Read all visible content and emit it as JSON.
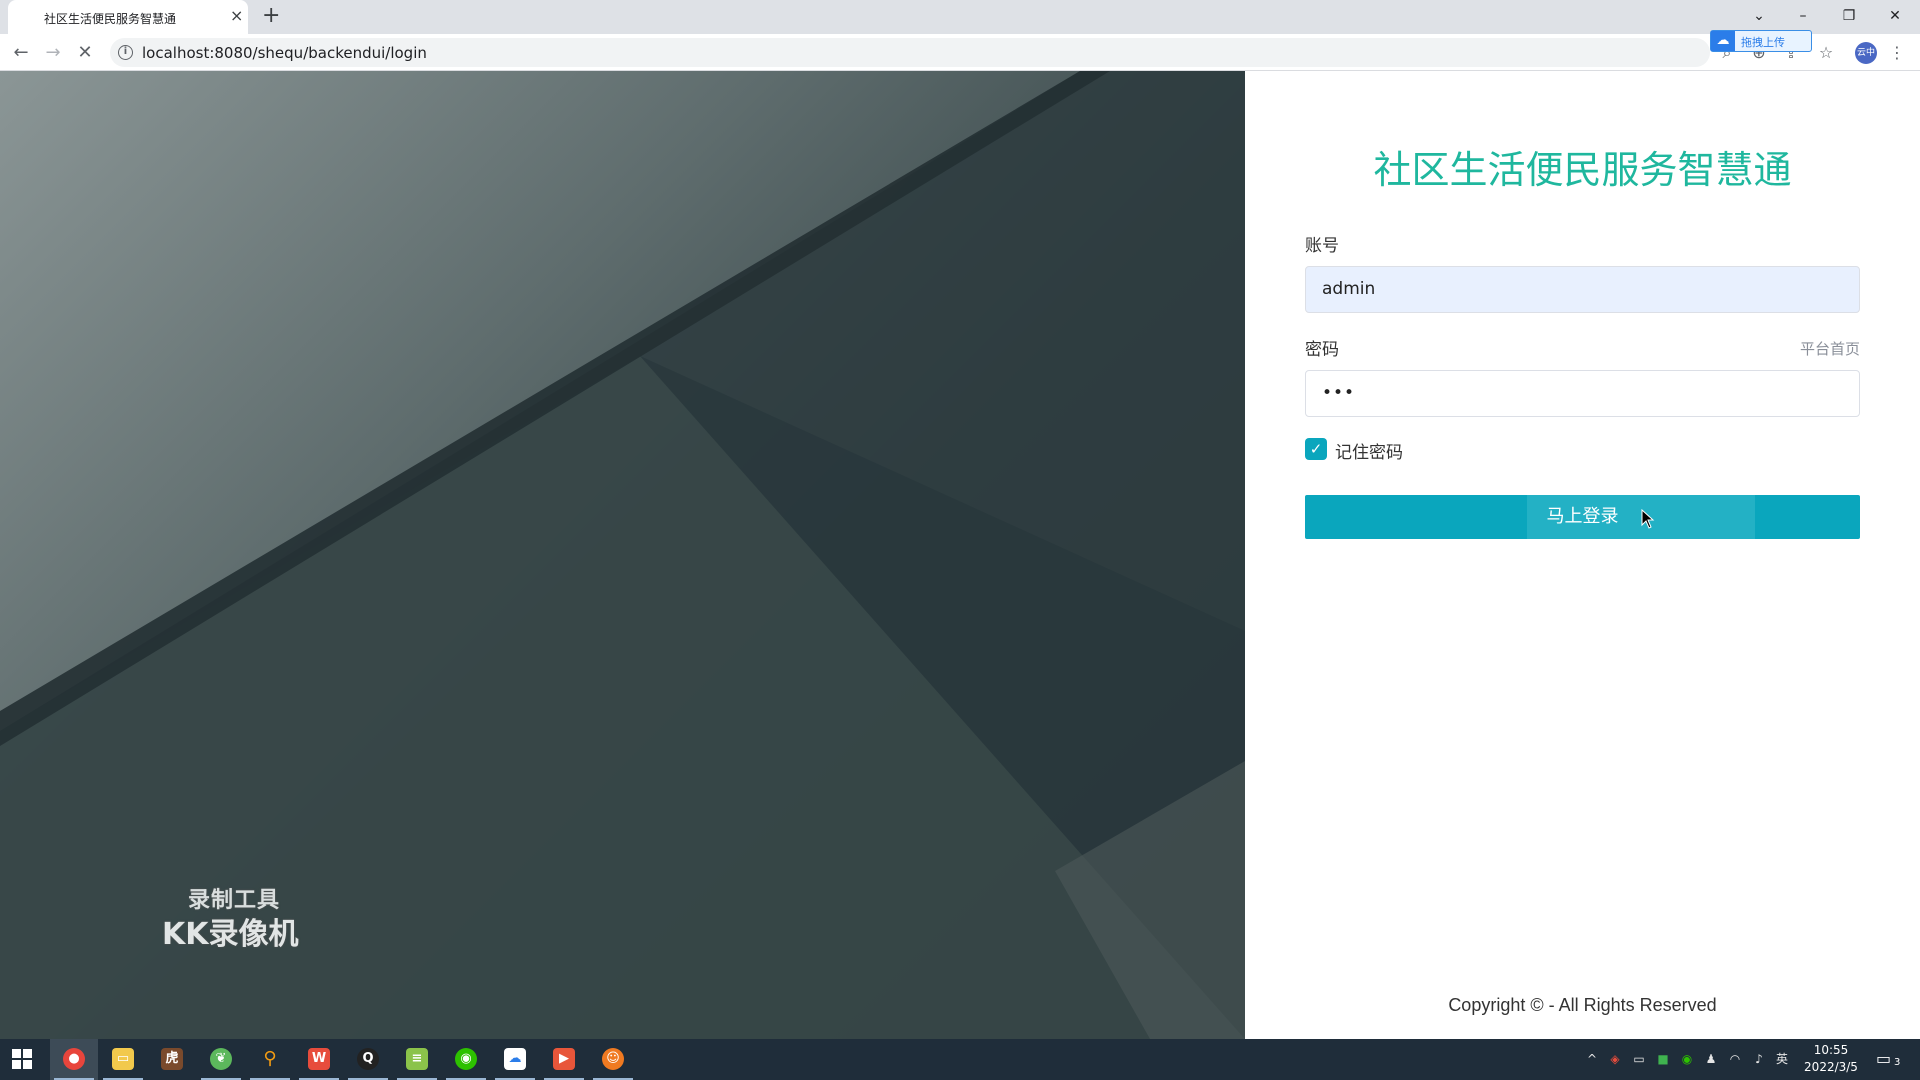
{
  "browser": {
    "tab_title": "社区生活便民服务智慧通",
    "tab_close": "×",
    "new_tab": "+",
    "url": "localhost:8080/shequ/backendui/login",
    "upload_button": "拖拽上传",
    "profile_label": "云中"
  },
  "login": {
    "title": "社区生活便民服务智慧通",
    "account_label": "账号",
    "account_value": "admin",
    "password_label": "密码",
    "password_value": "•••",
    "home_link": "平台首页",
    "remember_label": "记住密码",
    "remember_checked": true,
    "login_button": "马上登录",
    "copyright": "Copyright © - All Rights Reserved",
    "accent_color": "#0aa6bd",
    "title_color": "#1fb79e"
  },
  "watermark": {
    "line1": "录制工具",
    "line2": "KK录像机"
  },
  "taskbar": {
    "apps": [
      "chrome",
      "file-explorer",
      "tiger-app",
      "leaf-app",
      "search-app",
      "wps",
      "qq",
      "notepad",
      "wechat",
      "baidu-netdisk",
      "video-app",
      "sunglasses-app"
    ],
    "ime": "英",
    "time": "10:55",
    "date": "2022/3/5",
    "notification_count": "3"
  }
}
